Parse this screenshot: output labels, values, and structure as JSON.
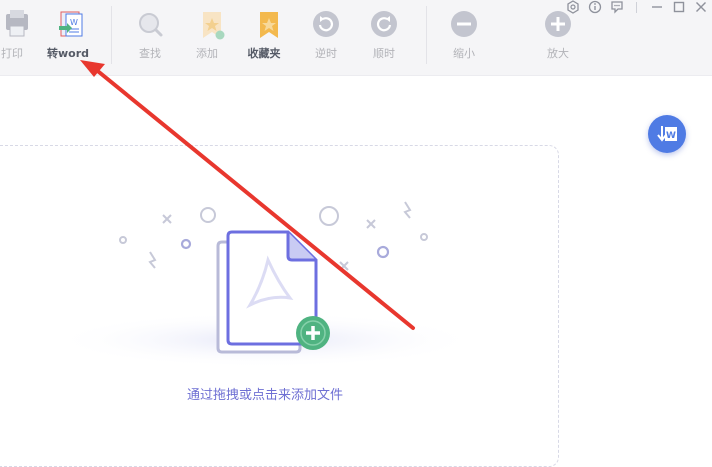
{
  "toolbar": {
    "print_label": "打印",
    "to_word_label": "转word",
    "find_label": "查找",
    "add_label": "添加",
    "favorites_label": "收藏夹",
    "rotate_ccw_label": "逆时",
    "rotate_cw_label": "顺时",
    "zoom_out_label": "缩小",
    "zoom_in_label": "放大"
  },
  "window_controls": [
    "settings-icon",
    "info-icon",
    "feedback-icon",
    "minimize-icon",
    "maximize-icon",
    "close-icon"
  ],
  "dropzone": {
    "hint": "通过拖拽或点击来添加文件"
  },
  "colors": {
    "accent": "#6e6fd3",
    "fab": "#4f7be4",
    "plus_badge": "#4fb381",
    "arrow": "#e8372e",
    "favorite_star": "#f3b94e"
  }
}
